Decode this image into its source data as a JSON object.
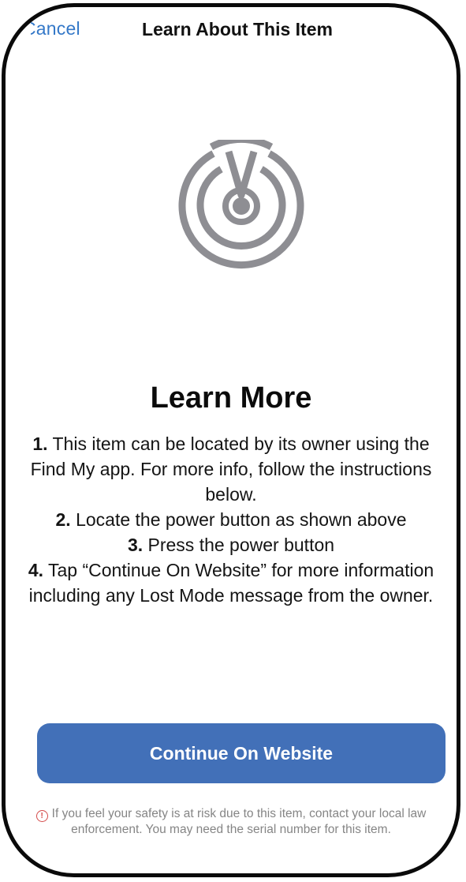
{
  "nav": {
    "cancel_label": "Cancel",
    "title": "Learn About This Item"
  },
  "hero": {
    "icon": "find-my-radar-icon",
    "icon_color": "#8e8e93"
  },
  "content": {
    "heading": "Learn More",
    "steps": [
      {
        "num": "1.",
        "text": " This item can be located by its owner using the Find My app. For more info, follow the instructions below."
      },
      {
        "num": "2.",
        "text": " Locate the power button as shown above"
      },
      {
        "num": "3.",
        "text": " Press the power button"
      },
      {
        "num": "4.",
        "text": " Tap “Continue On Website” for more information including any Lost Mode message from the owner."
      }
    ]
  },
  "actions": {
    "continue_label": "Continue On Website",
    "continue_color": "#4270b8"
  },
  "footer": {
    "alert_icon": "alert-circle-icon",
    "note": "If you feel your safety is at risk due to this item, contact your local law enforcement. You may need the serial number for this item."
  }
}
